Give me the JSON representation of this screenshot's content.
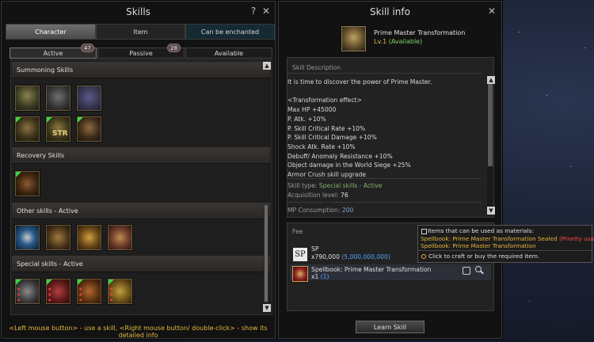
{
  "skills_panel": {
    "title": "Skills",
    "help_label": "?",
    "close_label": "✕",
    "tabs": [
      {
        "label": "Character"
      },
      {
        "label": "Item"
      },
      {
        "label": "Can be enchanted"
      }
    ],
    "subtabs": [
      {
        "label": "Active",
        "count": "47"
      },
      {
        "label": "Passive",
        "count": "28"
      },
      {
        "label": "Available",
        "count": ""
      }
    ],
    "sections": [
      {
        "title": "Summoning Skills"
      },
      {
        "title": "Recovery Skills"
      },
      {
        "title": "Other skills - Active"
      },
      {
        "title": "Special skills - Active"
      }
    ],
    "icon_text": "STR",
    "hint": "<Left mouse button> - use a skill, <Right mouse button/ double-click> - show its detailed info"
  },
  "info_panel": {
    "title": "Skill info",
    "close_label": "✕",
    "skill_name": "Prime Master Transformation",
    "skill_level": "Lv.1",
    "skill_status": "(Available)",
    "description_header": "Skill Description",
    "description_lines": [
      "It is time to discover the power of Prime Master.",
      "",
      "<Transformation effect>",
      "Max HP +45000",
      "P. Atk. +10%",
      "P. Skill Critical Rate +10%",
      "P. Skill Critical Damage +10%",
      "Shock Atk. Rate +10%",
      "Debuff/ Anomaly Resistance +10%",
      "Object damage in the World Siege +25%",
      "Armor Crush skill upgrade"
    ],
    "skill_type_label": "Skill type:",
    "skill_type_value": "Special skills - Active",
    "acq_label": "Acquisition level:",
    "acq_value": "76",
    "mp_label": "MP Consumption:",
    "mp_value": "200",
    "fee_header": "Fee",
    "sp_name": "SP",
    "sp_amount": "x790,000",
    "sp_owned": "(5,000,000,000)",
    "book_name": "Spellbook: Prime Master Transformation",
    "book_amount": "x1",
    "book_owned": "(1)",
    "learn_button": "Learn Skill",
    "scroll_up": "▲",
    "scroll_down": "▼"
  },
  "tooltip": {
    "title": "Items that can be used as materials:",
    "line1_name": "Spellbook: Prime Master Transformation",
    "line1_tag": "Sealed",
    "line1_note": "(Priority usage)",
    "line2_name": "Spellbook: Prime Master Transformation",
    "footer": "Click to craft or buy the required item."
  },
  "colors": {
    "gold": "#e4b83c",
    "green": "#7fd36a",
    "blue": "#5aa0ff",
    "red": "#ff4c4c"
  },
  "icons": [
    "help-icon",
    "close-icon",
    "scroll-up-icon",
    "scroll-down-icon",
    "refresh-icon",
    "search-icon",
    "wrench-icon",
    "skill-icon",
    "sp-icon",
    "spellbook-icon"
  ]
}
